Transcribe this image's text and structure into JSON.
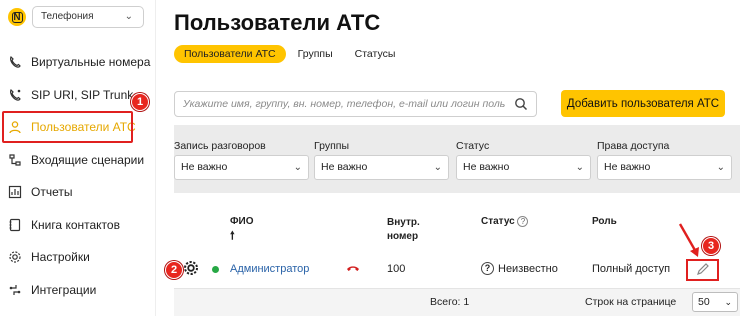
{
  "sidebar": {
    "logo_letter": "N",
    "module_select": "Телефония",
    "items": [
      {
        "label": "Виртуальные номера",
        "icon": "phone-forward-icon"
      },
      {
        "label": "SIP URI, SIP Trunk",
        "icon": "sip-phone-icon"
      },
      {
        "label": "Пользователи АТС",
        "icon": "user-icon",
        "active": true
      },
      {
        "label": "Входящие сценарии",
        "icon": "incoming-scenario-icon"
      },
      {
        "label": "Отчеты",
        "icon": "report-icon"
      },
      {
        "label": "Книга контактов",
        "icon": "contacts-book-icon"
      },
      {
        "label": "Настройки",
        "icon": "gear-icon"
      },
      {
        "label": "Интеграции",
        "icon": "integrations-icon"
      }
    ]
  },
  "main": {
    "title": "Пользователи АТС",
    "tabs": [
      {
        "label": "Пользователи АТС",
        "active": true
      },
      {
        "label": "Группы"
      },
      {
        "label": "Статусы"
      }
    ],
    "search_placeholder": "Укажите имя, группу, вн. номер, телефон, e-mail или логин пользовател...",
    "add_button": "Добавить пользователя АТС",
    "filters": [
      {
        "label": "Запись разговоров",
        "value": "Не важно"
      },
      {
        "label": "Группы",
        "value": "Не важно"
      },
      {
        "label": "Статус",
        "value": "Не важно"
      },
      {
        "label": "Права доступа",
        "value": "Не важно"
      }
    ],
    "table": {
      "col_name": "ФИО",
      "col_number_line1": "Внутр.",
      "col_number_line2": "номер",
      "col_status": "Статус",
      "col_role": "Роль",
      "rows": [
        {
          "name": "Администратор",
          "number": "100",
          "status": "Неизвестно",
          "role": "Полный доступ"
        }
      ],
      "total": "Всего: 1",
      "rows_per_page_label": "Строк на странице",
      "rows_per_page": "50"
    }
  },
  "annotations": {
    "badge1": "1",
    "badge2": "2",
    "badge3": "3"
  },
  "colors": {
    "accent": "#ffc400",
    "annotation": "#e0201f",
    "link": "#2a63a8",
    "online": "#27a845",
    "hangup": "#d32020"
  }
}
